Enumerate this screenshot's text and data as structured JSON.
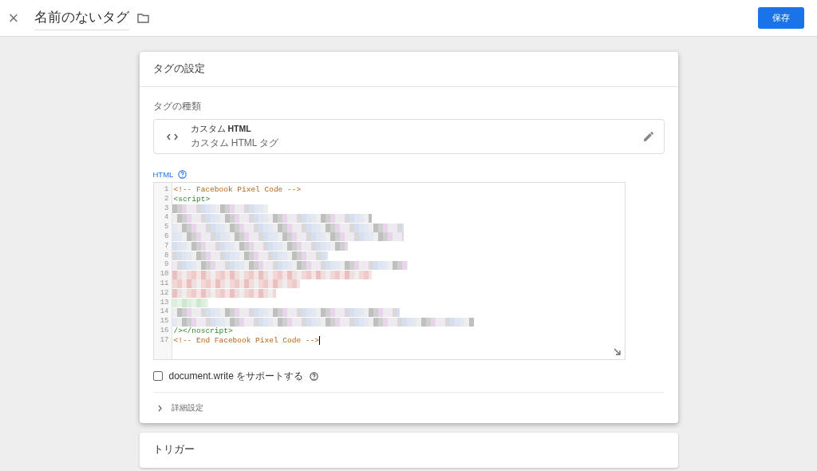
{
  "header": {
    "close_icon": "×",
    "title": "名前のないタグ",
    "save_button": "保存"
  },
  "tag_config": {
    "title": "タグの設定",
    "type_label": "タグの種類",
    "type_name_prefix": "カスタム ",
    "type_name_bold": "HTML",
    "type_desc": "カスタム HTML タグ",
    "html_label": "HTML",
    "code_lines": [
      {
        "number": "1",
        "kind": "code",
        "cursor": false,
        "segments": [
          {
            "text": "<!-- Facebook Pixel Code -->",
            "kind": "comment"
          }
        ]
      },
      {
        "number": "2",
        "kind": "code",
        "cursor": false,
        "segments": [
          {
            "text": "<script>",
            "kind": "tag"
          }
        ]
      },
      {
        "number": "3",
        "kind": "redacted",
        "cursor": false
      },
      {
        "number": "4",
        "kind": "redacted",
        "cursor": false
      },
      {
        "number": "5",
        "kind": "redacted",
        "cursor": false
      },
      {
        "number": "6",
        "kind": "redacted",
        "cursor": false
      },
      {
        "number": "7",
        "kind": "redacted",
        "cursor": false
      },
      {
        "number": "8",
        "kind": "redacted",
        "cursor": false
      },
      {
        "number": "9",
        "kind": "redacted",
        "cursor": false
      },
      {
        "number": "10",
        "kind": "redacted",
        "cursor": false
      },
      {
        "number": "11",
        "kind": "redacted",
        "cursor": false
      },
      {
        "number": "12",
        "kind": "redacted",
        "cursor": false
      },
      {
        "number": "13",
        "kind": "redacted",
        "cursor": false
      },
      {
        "number": "14",
        "kind": "redacted",
        "cursor": false
      },
      {
        "number": "15",
        "kind": "redacted",
        "cursor": false
      },
      {
        "number": "16",
        "kind": "code",
        "cursor": false,
        "segments": [
          {
            "text": "/></noscript>",
            "kind": "tag"
          }
        ]
      },
      {
        "number": "17",
        "kind": "code",
        "cursor": true,
        "segments": [
          {
            "text": "<!-- End Facebook Pixel Code -->",
            "kind": "comment"
          }
        ]
      }
    ],
    "document_write": {
      "label": "document.write をサポートする",
      "checked": false
    },
    "advanced": {
      "label": "詳細設定",
      "expanded": false
    }
  },
  "trigger": {
    "title": "トリガー"
  }
}
